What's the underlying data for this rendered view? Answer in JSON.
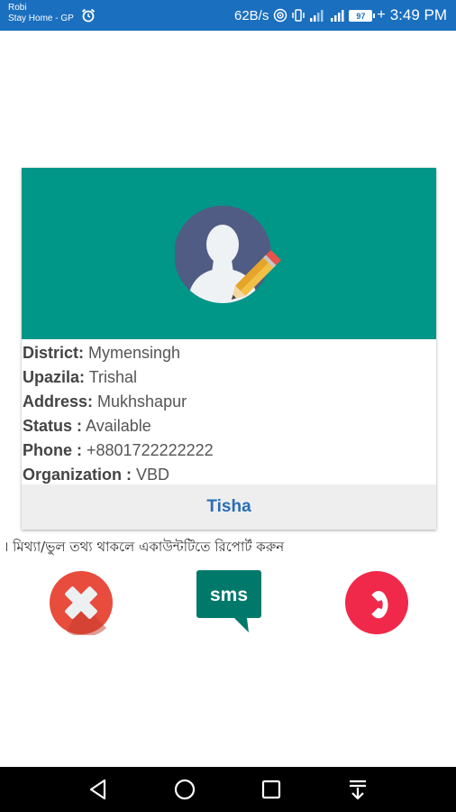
{
  "status_bar": {
    "carrier_line1": "Robi",
    "carrier_line2": "Stay Home - GP",
    "net_speed": "62B/s",
    "battery": "97",
    "battery_level": 0.97,
    "time": "3:49 PM"
  },
  "profile": {
    "header_color": "#009688",
    "fields": [
      {
        "label": "District:",
        "value": " Mymensingh"
      },
      {
        "label": "Upazila:",
        "value": " Trishal"
      },
      {
        "label": "Address:",
        "value": " Mukhshapur"
      },
      {
        "label": "Status :",
        "value": " Available"
      },
      {
        "label": "Phone :",
        "value": " +8801722222222"
      },
      {
        "label": "Organization :",
        "value": " VBD"
      }
    ],
    "name": "Tisha"
  },
  "report_text": "। মিথ্যা/ভুল তথ্য  থাকলে একাউন্টটিতে রিপোর্ট করুন",
  "actions": {
    "sms_label": "sms",
    "cancel_color": "#e84c3d",
    "sms_color": "#00796b",
    "call_color": "#f0284a"
  },
  "icons": [
    "alarm-icon",
    "wifi-icon",
    "vibrate-icon",
    "signal-icon",
    "battery-icon",
    "avatar-edit-icon",
    "close-icon",
    "sms-icon",
    "phone-icon",
    "back-icon",
    "home-icon",
    "recents-icon",
    "notification-pull-icon"
  ]
}
